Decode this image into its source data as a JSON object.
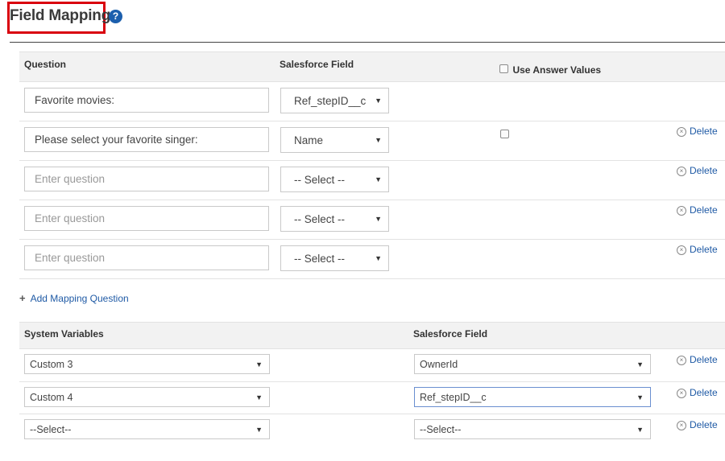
{
  "header": {
    "title": "Field Mapping",
    "help_icon": "question-circle-icon",
    "help_glyph": "?",
    "highlight_color": "#d9000d"
  },
  "mapping": {
    "columns": {
      "question": "Question",
      "salesforce_field": "Salesforce Field",
      "use_answer_values": "Use Answer Values"
    },
    "rows": [
      {
        "question_value": "Favorite movies:",
        "question_placeholder": "Enter question",
        "field": "Ref_stepID__c",
        "show_checkbox": false,
        "show_delete": false
      },
      {
        "question_value": "Please select your favorite singer:",
        "question_placeholder": "Enter question",
        "field": "Name",
        "show_checkbox": true,
        "show_delete": true
      },
      {
        "question_value": "",
        "question_placeholder": "Enter question",
        "field": "-- Select --",
        "show_checkbox": false,
        "show_delete": true
      },
      {
        "question_value": "",
        "question_placeholder": "Enter question",
        "field": "-- Select --",
        "show_checkbox": false,
        "show_delete": true
      },
      {
        "question_value": "",
        "question_placeholder": "Enter question",
        "field": "-- Select --",
        "show_checkbox": false,
        "show_delete": true
      }
    ],
    "delete_label": "Delete",
    "add_label": "Add Mapping Question"
  },
  "system_variables": {
    "columns": {
      "system_variables": "System Variables",
      "salesforce_field": "Salesforce Field"
    },
    "rows": [
      {
        "variable": "Custom 3",
        "field": "OwnerId",
        "show_delete": true
      },
      {
        "variable": "Custom 4",
        "field": "Ref_stepID__c",
        "show_delete": true
      },
      {
        "variable": "--Select--",
        "field": "--Select--",
        "show_delete": true
      }
    ],
    "delete_label": "Delete"
  },
  "icons": {
    "caret": "▼",
    "delete": "⊗",
    "add": "+"
  },
  "colors": {
    "link": "#1f5aa5",
    "help_icon": "#1c5fad",
    "header_bg": "#f2f2f2"
  }
}
